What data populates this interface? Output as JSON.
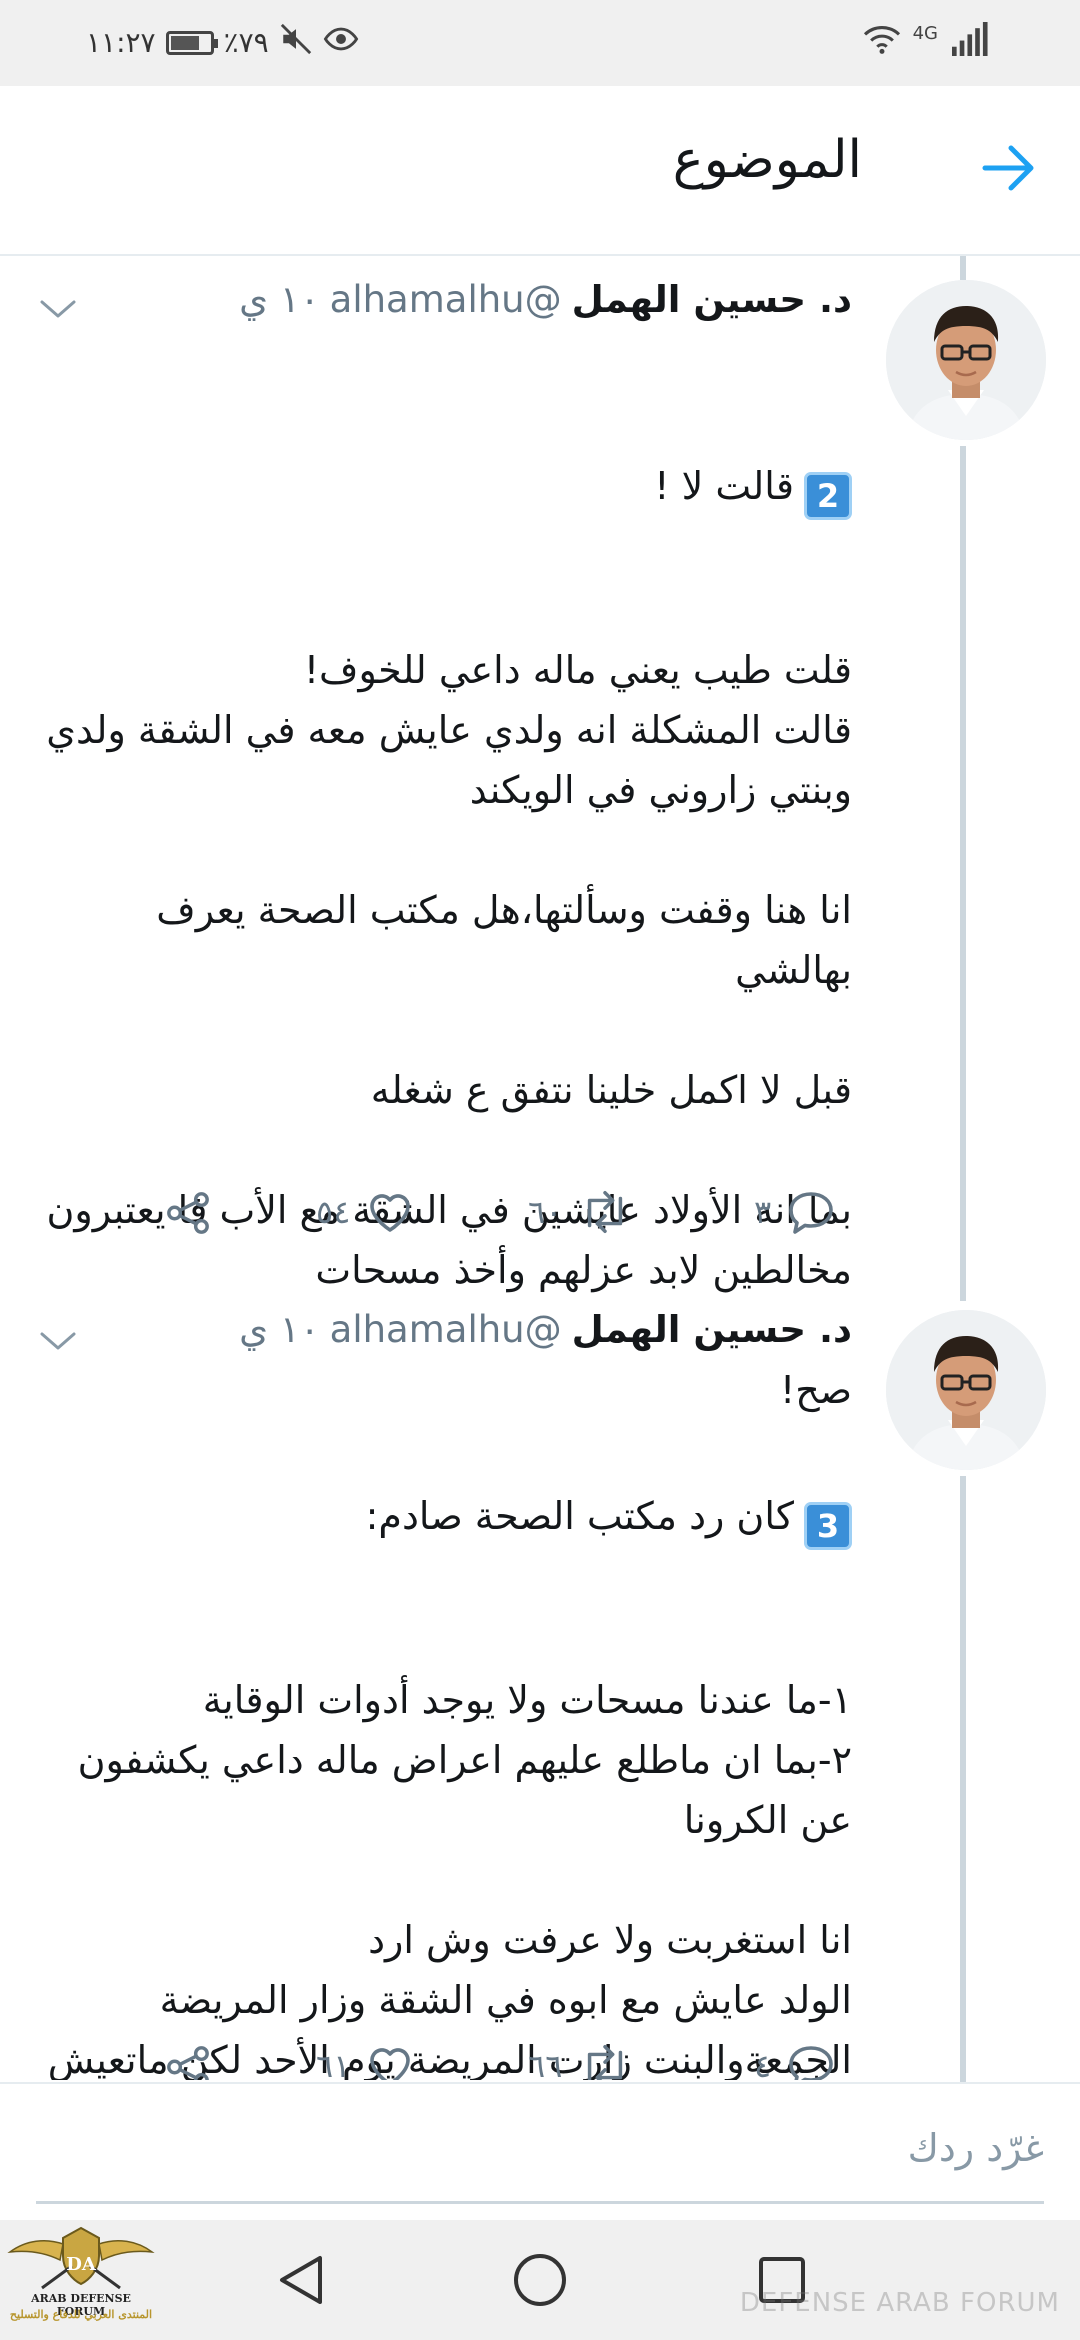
{
  "status_bar": {
    "time": "١١:٢٧",
    "battery": "٪٧٩",
    "battery_level": 0.79,
    "network": "4G"
  },
  "header": {
    "title": "الموضوع"
  },
  "tweets": [
    {
      "name": "د. حسين الهمل",
      "handle": "@alhamalhu",
      "time": "١٠ ي",
      "number_emoji": "2",
      "first_line": "قالت لا !",
      "text": "قلت طيب يعني ماله داعي للخوف!\nقالت المشكلة انه ولدي عايش معه في الشقة ولدي وبنتي زاروني في الويكند\n\nانا هنا وقفت وسألتها،هل مكتب الصحة يعرف بهالشي\n\nقبل لا اكمل خلينا نتفق ع شغله\n\nبما انه الأولاد عايشين في الشقة مع الأب فا يعتبرون مخالطين لابد عزلهم وأخذ مسحات\n\nصح!",
      "replies": "٣",
      "retweets": "٦٠",
      "likes": "٥٤"
    },
    {
      "name": "د. حسين الهمل",
      "handle": "@alhamalhu",
      "time": "١٠ ي",
      "number_emoji": "3",
      "first_line": "كان رد مكتب الصحة صادم:",
      "text": "١-ما عندنا مسحات ولا يوجد أدوات الوقاية\n٢-بما ان ماطلع عليهم اعراض ماله داعي يكشفون عن الكرونا\n\nانا استغربت ولا عرفت وش ارد\nالولد عايش مع ابوه في الشقة وزار المريضة الجمعةوالبنت زارت المريضة يوم الأحد لكن ماتعيش مع الأب ف الشقة\n\nقالت لي المشكلة مو هنا",
      "replies": "٤",
      "retweets": "٦٦",
      "likes": "٦١"
    }
  ],
  "reply": {
    "placeholder": "غرّد ردك"
  },
  "logo": {
    "line1": "DA",
    "line2": "ARAB DEFENSE FORUM",
    "line3": "المنتدى العربي للدفاع والتسليح"
  },
  "watermark": {
    "text": "DEFENSE ARAB FORUM"
  },
  "colors": {
    "accent": "#1da1f2",
    "secondary_text": "#657786",
    "thread_line": "#ccd6dd"
  }
}
